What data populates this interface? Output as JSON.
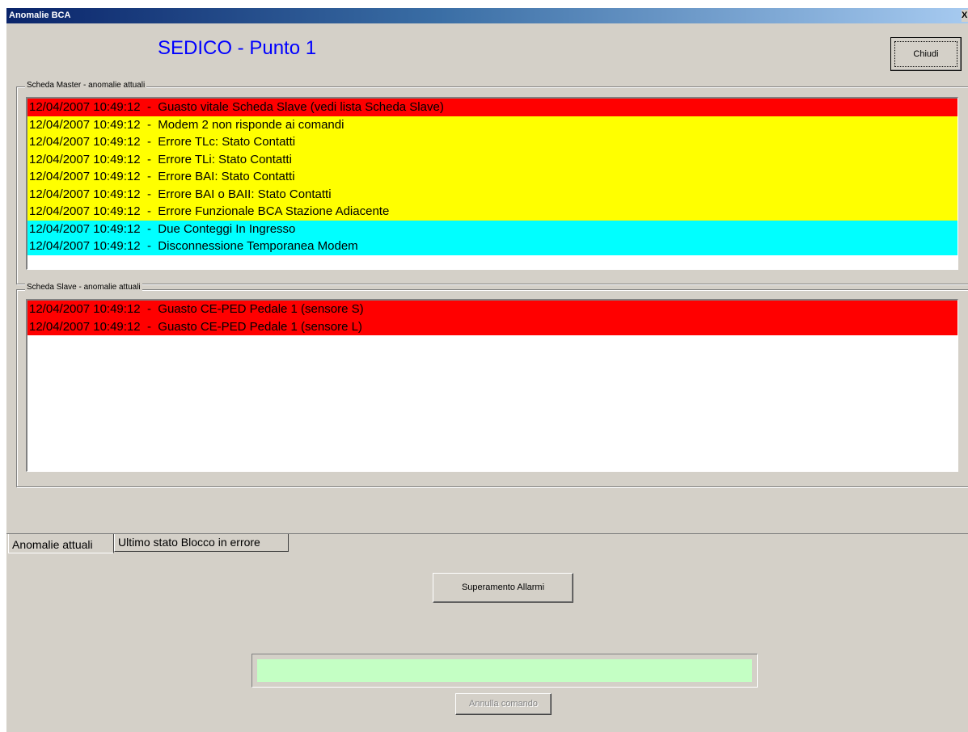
{
  "window": {
    "title": "Anomalie BCA",
    "close_glyph": "X"
  },
  "header": {
    "station_title": "SEDICO - Punto 1",
    "close_label": "Chiudi"
  },
  "master": {
    "group_label": "Scheda Master - anomalie attuali",
    "rows": [
      {
        "text": "12/04/2007 10:49:12  -  Guasto vitale Scheda Slave (vedi lista Scheda Slave)",
        "severity": "red"
      },
      {
        "text": "12/04/2007 10:49:12  -  Modem 2 non risponde ai comandi",
        "severity": "yellow"
      },
      {
        "text": "12/04/2007 10:49:12  -  Errore TLc: Stato Contatti",
        "severity": "yellow"
      },
      {
        "text": "12/04/2007 10:49:12  -  Errore TLi: Stato Contatti",
        "severity": "yellow"
      },
      {
        "text": "12/04/2007 10:49:12  -  Errore BAI: Stato Contatti",
        "severity": "yellow"
      },
      {
        "text": "12/04/2007 10:49:12  -  Errore BAI o BAII: Stato Contatti",
        "severity": "yellow"
      },
      {
        "text": "12/04/2007 10:49:12  -  Errore Funzionale BCA Stazione Adiacente",
        "severity": "yellow"
      },
      {
        "text": "12/04/2007 10:49:12  -  Due Conteggi In Ingresso",
        "severity": "cyan"
      },
      {
        "text": "12/04/2007 10:49:12  -  Disconnessione Temporanea Modem",
        "severity": "cyan"
      }
    ]
  },
  "slave": {
    "group_label": "Scheda Slave - anomalie attuali",
    "rows": [
      {
        "text": "12/04/2007 10:49:12  -  Guasto CE-PED Pedale 1 (sensore S)",
        "severity": "red"
      },
      {
        "text": "12/04/2007 10:49:12  -  Guasto CE-PED Pedale 1 (sensore L)",
        "severity": "red"
      }
    ]
  },
  "tabs": [
    {
      "label": "Anomalie attuali",
      "active": true
    },
    {
      "label": "Ultimo stato Blocco in errore",
      "active": false
    }
  ],
  "actions": {
    "override_label": "Superamento Allarmi",
    "cancel_label": "Annulla comando",
    "status_text": ""
  },
  "colors": {
    "red": "#ff0000",
    "yellow": "#ffff00",
    "cyan": "#00ffff",
    "status_bg": "#c4ffc4",
    "title_blue": "#0000ff"
  }
}
